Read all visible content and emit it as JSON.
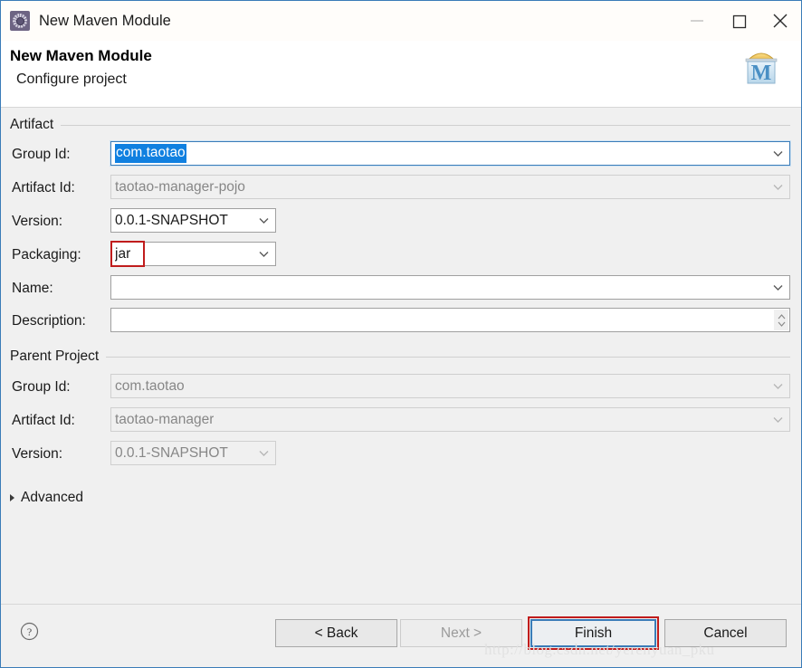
{
  "window": {
    "title": "New Maven Module",
    "app_icon": "maven-gear-icon",
    "minimize_label": "Minimize",
    "maximize_label": "Maximize",
    "close_label": "Close"
  },
  "header": {
    "title": "New Maven Module",
    "subtitle": "Configure project",
    "logo": "maven-m-icon"
  },
  "artifact": {
    "group_title": "Artifact",
    "group_id": {
      "label": "Group Id:",
      "value": "com.taotao",
      "selected": true
    },
    "artifact_id": {
      "label": "Artifact Id:",
      "value": "taotao-manager-pojo",
      "disabled": true
    },
    "version": {
      "label": "Version:",
      "value": "0.0.1-SNAPSHOT"
    },
    "packaging": {
      "label": "Packaging:",
      "value": "jar",
      "annotated": true
    },
    "name": {
      "label": "Name:",
      "value": ""
    },
    "description": {
      "label": "Description:",
      "value": ""
    }
  },
  "parent_project": {
    "group_title": "Parent Project",
    "group_id": {
      "label": "Group Id:",
      "value": "com.taotao",
      "disabled": true
    },
    "artifact_id": {
      "label": "Artifact Id:",
      "value": "taotao-manager",
      "disabled": true
    },
    "version": {
      "label": "Version:",
      "value": "0.0.1-SNAPSHOT",
      "disabled": true
    }
  },
  "advanced": {
    "label": "Advanced",
    "expanded": false
  },
  "footer": {
    "help": "help-icon",
    "back": "< Back",
    "next": "Next >",
    "finish": "Finish",
    "cancel": "Cancel",
    "next_disabled": true,
    "finish_focused": true,
    "finish_annotated": true
  },
  "watermark": "http://blog.csdn.net/yerenyuan_pku",
  "colors": {
    "accent_blue": "#3a7cb8",
    "selection_blue": "#1080e0",
    "annotation_red": "#c01c1c",
    "dialog_bg": "#f0f0f0",
    "disabled_text": "#878787"
  }
}
